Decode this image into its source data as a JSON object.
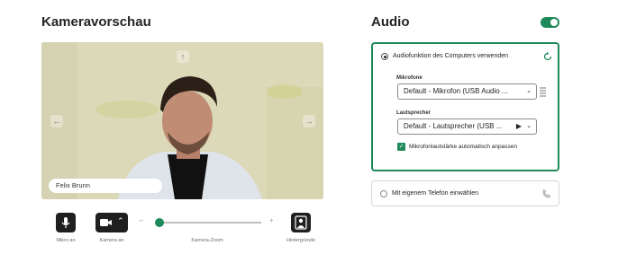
{
  "camera": {
    "title": "Kameravorschau",
    "participant_name": "Felix Brunn",
    "mic_label": "Mikro an",
    "camera_label": "Kamera an",
    "zoom_label": "Kamera-Zoom",
    "zoom_minus": "–",
    "zoom_plus": "+",
    "zoom_level": 0.02,
    "backgrounds_label": "Hintergründe"
  },
  "audio": {
    "title": "Audio",
    "enabled": true,
    "computer_audio_label": "Audiofunktion des Computers verwenden",
    "microphone_heading": "Mikrofone",
    "microphone_value": "Default - Mikrofon (USB Audio ...",
    "speaker_heading": "Lautsprecher",
    "speaker_value": "Default - Lautsprecher (USB ...",
    "auto_adjust_label": "Mikrofonlautstärke automatisch anpassen",
    "auto_adjust_checked": true,
    "phone_label": "Mit eigenem Telefon einwählen"
  },
  "colors": {
    "accent": "#1e8a5a",
    "button_dark": "#1f1f1f"
  }
}
